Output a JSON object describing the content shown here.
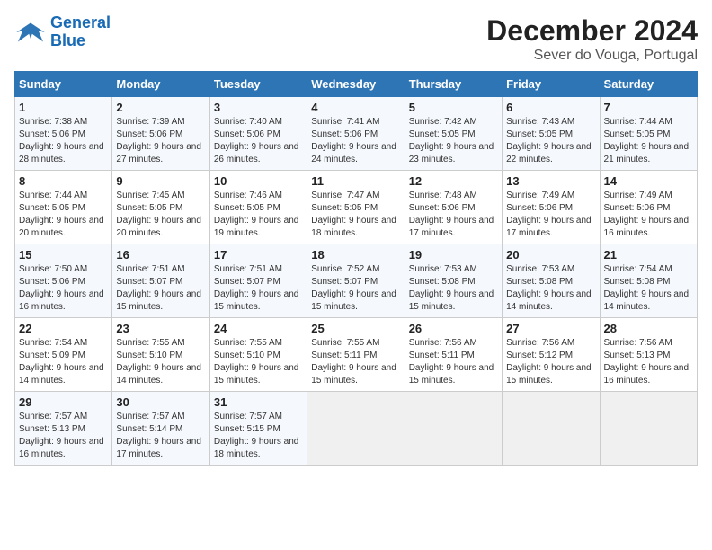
{
  "header": {
    "logo_line1": "General",
    "logo_line2": "Blue",
    "title": "December 2024",
    "subtitle": "Sever do Vouga, Portugal"
  },
  "calendar": {
    "days_of_week": [
      "Sunday",
      "Monday",
      "Tuesday",
      "Wednesday",
      "Thursday",
      "Friday",
      "Saturday"
    ],
    "weeks": [
      [
        {
          "day": "1",
          "sunrise": "7:38 AM",
          "sunset": "5:06 PM",
          "daylight": "9 hours and 28 minutes."
        },
        {
          "day": "2",
          "sunrise": "7:39 AM",
          "sunset": "5:06 PM",
          "daylight": "9 hours and 27 minutes."
        },
        {
          "day": "3",
          "sunrise": "7:40 AM",
          "sunset": "5:06 PM",
          "daylight": "9 hours and 26 minutes."
        },
        {
          "day": "4",
          "sunrise": "7:41 AM",
          "sunset": "5:06 PM",
          "daylight": "9 hours and 24 minutes."
        },
        {
          "day": "5",
          "sunrise": "7:42 AM",
          "sunset": "5:05 PM",
          "daylight": "9 hours and 23 minutes."
        },
        {
          "day": "6",
          "sunrise": "7:43 AM",
          "sunset": "5:05 PM",
          "daylight": "9 hours and 22 minutes."
        },
        {
          "day": "7",
          "sunrise": "7:44 AM",
          "sunset": "5:05 PM",
          "daylight": "9 hours and 21 minutes."
        }
      ],
      [
        {
          "day": "8",
          "sunrise": "7:44 AM",
          "sunset": "5:05 PM",
          "daylight": "9 hours and 20 minutes."
        },
        {
          "day": "9",
          "sunrise": "7:45 AM",
          "sunset": "5:05 PM",
          "daylight": "9 hours and 20 minutes."
        },
        {
          "day": "10",
          "sunrise": "7:46 AM",
          "sunset": "5:05 PM",
          "daylight": "9 hours and 19 minutes."
        },
        {
          "day": "11",
          "sunrise": "7:47 AM",
          "sunset": "5:05 PM",
          "daylight": "9 hours and 18 minutes."
        },
        {
          "day": "12",
          "sunrise": "7:48 AM",
          "sunset": "5:06 PM",
          "daylight": "9 hours and 17 minutes."
        },
        {
          "day": "13",
          "sunrise": "7:49 AM",
          "sunset": "5:06 PM",
          "daylight": "9 hours and 17 minutes."
        },
        {
          "day": "14",
          "sunrise": "7:49 AM",
          "sunset": "5:06 PM",
          "daylight": "9 hours and 16 minutes."
        }
      ],
      [
        {
          "day": "15",
          "sunrise": "7:50 AM",
          "sunset": "5:06 PM",
          "daylight": "9 hours and 16 minutes."
        },
        {
          "day": "16",
          "sunrise": "7:51 AM",
          "sunset": "5:07 PM",
          "daylight": "9 hours and 15 minutes."
        },
        {
          "day": "17",
          "sunrise": "7:51 AM",
          "sunset": "5:07 PM",
          "daylight": "9 hours and 15 minutes."
        },
        {
          "day": "18",
          "sunrise": "7:52 AM",
          "sunset": "5:07 PM",
          "daylight": "9 hours and 15 minutes."
        },
        {
          "day": "19",
          "sunrise": "7:53 AM",
          "sunset": "5:08 PM",
          "daylight": "9 hours and 15 minutes."
        },
        {
          "day": "20",
          "sunrise": "7:53 AM",
          "sunset": "5:08 PM",
          "daylight": "9 hours and 14 minutes."
        },
        {
          "day": "21",
          "sunrise": "7:54 AM",
          "sunset": "5:08 PM",
          "daylight": "9 hours and 14 minutes."
        }
      ],
      [
        {
          "day": "22",
          "sunrise": "7:54 AM",
          "sunset": "5:09 PM",
          "daylight": "9 hours and 14 minutes."
        },
        {
          "day": "23",
          "sunrise": "7:55 AM",
          "sunset": "5:10 PM",
          "daylight": "9 hours and 14 minutes."
        },
        {
          "day": "24",
          "sunrise": "7:55 AM",
          "sunset": "5:10 PM",
          "daylight": "9 hours and 15 minutes."
        },
        {
          "day": "25",
          "sunrise": "7:55 AM",
          "sunset": "5:11 PM",
          "daylight": "9 hours and 15 minutes."
        },
        {
          "day": "26",
          "sunrise": "7:56 AM",
          "sunset": "5:11 PM",
          "daylight": "9 hours and 15 minutes."
        },
        {
          "day": "27",
          "sunrise": "7:56 AM",
          "sunset": "5:12 PM",
          "daylight": "9 hours and 15 minutes."
        },
        {
          "day": "28",
          "sunrise": "7:56 AM",
          "sunset": "5:13 PM",
          "daylight": "9 hours and 16 minutes."
        }
      ],
      [
        {
          "day": "29",
          "sunrise": "7:57 AM",
          "sunset": "5:13 PM",
          "daylight": "9 hours and 16 minutes."
        },
        {
          "day": "30",
          "sunrise": "7:57 AM",
          "sunset": "5:14 PM",
          "daylight": "9 hours and 17 minutes."
        },
        {
          "day": "31",
          "sunrise": "7:57 AM",
          "sunset": "5:15 PM",
          "daylight": "9 hours and 18 minutes."
        },
        null,
        null,
        null,
        null
      ]
    ]
  }
}
